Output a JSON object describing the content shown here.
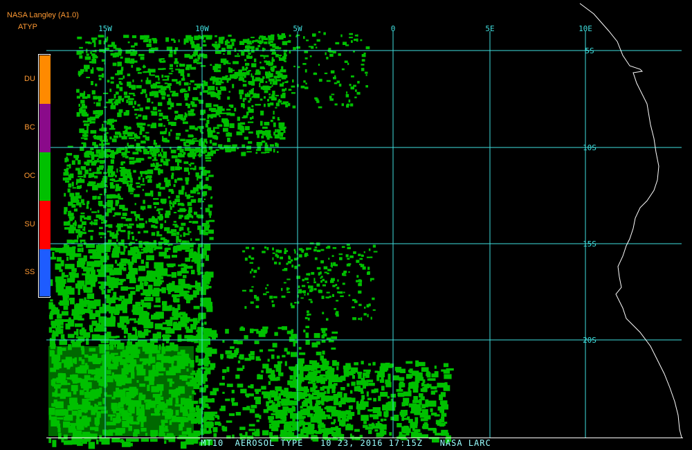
{
  "header": {
    "title": "NASA Langley (A1.0)",
    "product": "ATYP"
  },
  "legend": [
    {
      "code": "DU",
      "color": "#ff8a00"
    },
    {
      "code": "BC",
      "color": "#8a0a8a"
    },
    {
      "code": "OC",
      "color": "#00c000"
    },
    {
      "code": "SU",
      "color": "#ff0000"
    },
    {
      "code": "SS",
      "color": "#1e5cff"
    }
  ],
  "lon_labels": [
    "15W",
    "10W",
    "5W",
    "0",
    "5E",
    "10E"
  ],
  "lat_labels": [
    "5S",
    "10S",
    "15S",
    "20S"
  ],
  "colors": {
    "grid": "#40e0e0",
    "aerosol": "#00c000",
    "coastline": "#ffffff",
    "frame": "#ffffff",
    "label": "#ff9a33",
    "footer": "#99ffff"
  },
  "footer": {
    "text": "MT10  AEROSOL TYPE   10 23, 2016 17:15Z   NASA LARC"
  }
}
